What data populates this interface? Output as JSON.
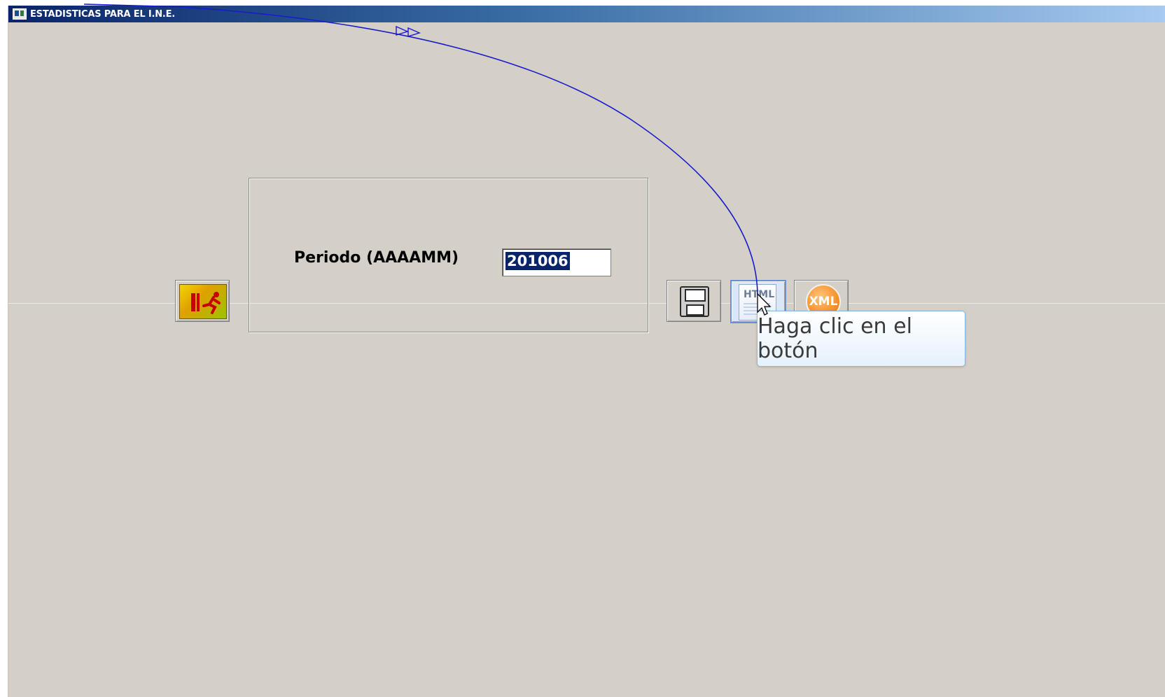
{
  "window": {
    "title": "ESTADISTICAS PARA EL I.N.E."
  },
  "form": {
    "period_label": "Periodo (AAAAMM)",
    "period_value": "201006"
  },
  "buttons": {
    "exit": {
      "icon": "exit-running-man-icon"
    },
    "save": {
      "icon": "floppy-disk-icon"
    },
    "html": {
      "icon": "html-document-icon",
      "label": "HTML"
    },
    "xml": {
      "icon": "xml-orange-circle-icon",
      "label": "XML"
    }
  },
  "tooltip": {
    "text": "Haga clic en el botón"
  },
  "annotation": {
    "color": "#1a1acc"
  }
}
